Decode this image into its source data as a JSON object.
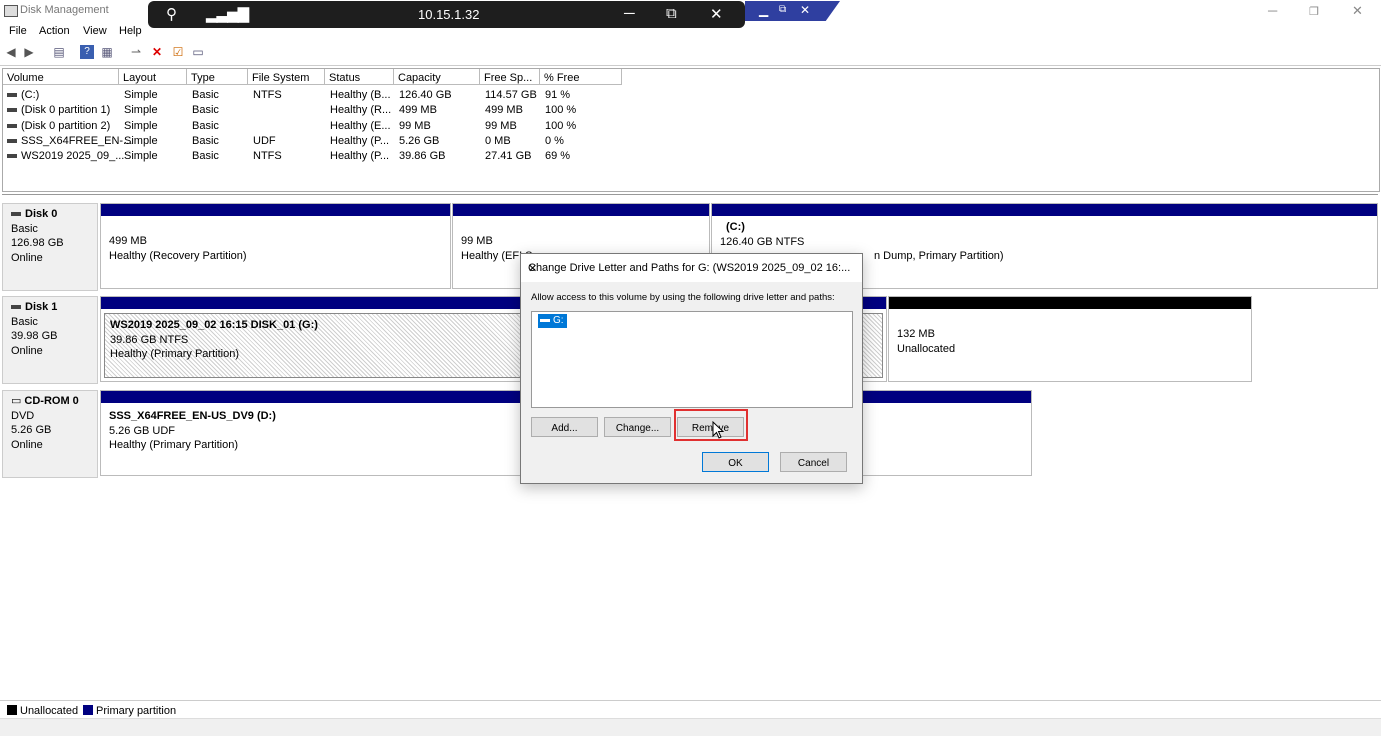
{
  "app": {
    "title": "Disk Management",
    "window_controls": {
      "minimize": "─",
      "restore": "❐",
      "close": "✕"
    }
  },
  "remote_bar": {
    "ip": "10.15.1.32",
    "icons": [
      "pin-off-icon",
      "signal-icon"
    ],
    "controls": {
      "minimize": "─",
      "restore": "⧉",
      "close": "✕"
    },
    "inner_controls": {
      "minimize": "▁",
      "restore": "⧉",
      "close": "✕"
    }
  },
  "menu": [
    "File",
    "Action",
    "View",
    "Help"
  ],
  "toolbar": [
    "back-icon",
    "forward-icon",
    "properties-icon",
    "help-icon",
    "view-icon",
    "rescan-icon",
    "delete-icon",
    "check-icon",
    "settings-icon"
  ],
  "volume_table": {
    "headers": [
      "Volume",
      "Layout",
      "Type",
      "File System",
      "Status",
      "Capacity",
      "Free Sp...",
      "% Free"
    ],
    "rows": [
      {
        "volume": "(C:)",
        "layout": "Simple",
        "type": "Basic",
        "fs": "NTFS",
        "status": "Healthy (B...",
        "capacity": "126.40 GB",
        "free": "114.57 GB",
        "pct": "91 %"
      },
      {
        "volume": "(Disk 0 partition 1)",
        "layout": "Simple",
        "type": "Basic",
        "fs": "",
        "status": "Healthy (R...",
        "capacity": "499 MB",
        "free": "499 MB",
        "pct": "100 %"
      },
      {
        "volume": "(Disk 0 partition 2)",
        "layout": "Simple",
        "type": "Basic",
        "fs": "",
        "status": "Healthy (E...",
        "capacity": "99 MB",
        "free": "99 MB",
        "pct": "100 %"
      },
      {
        "volume": "SSS_X64FREE_EN-...",
        "layout": "Simple",
        "type": "Basic",
        "fs": "UDF",
        "status": "Healthy (P...",
        "capacity": "5.26 GB",
        "free": "0 MB",
        "pct": "0 %"
      },
      {
        "volume": "WS2019 2025_09_...",
        "layout": "Simple",
        "type": "Basic",
        "fs": "NTFS",
        "status": "Healthy (P...",
        "capacity": "39.86 GB",
        "free": "27.41 GB",
        "pct": "69 %"
      }
    ]
  },
  "disks": {
    "disk0": {
      "name": "Disk 0",
      "type": "Basic",
      "size": "126.98 GB",
      "status": "Online",
      "p1": {
        "size": "499 MB",
        "status": "Healthy (Recovery Partition)"
      },
      "p2": {
        "size": "99 MB",
        "status": "Healthy (EFI S"
      },
      "p3": {
        "label": "(C:)",
        "size": "126.40 GB NTFS",
        "status": "n Dump, Primary Partition)"
      }
    },
    "disk1": {
      "name": "Disk 1",
      "type": "Basic",
      "size": "39.98 GB",
      "status": "Online",
      "p1": {
        "label": "WS2019 2025_09_02 16:15 DISK_01  (G:)",
        "size": "39.86 GB NTFS",
        "status": "Healthy (Primary Partition)"
      },
      "p2": {
        "size": "132 MB",
        "status": "Unallocated"
      }
    },
    "cdrom0": {
      "name": "CD-ROM 0",
      "type": "DVD",
      "size": "5.26 GB",
      "status": "Online",
      "p1": {
        "label": "SSS_X64FREE_EN-US_DV9  (D:)",
        "size": "5.26 GB UDF",
        "status": "Healthy (Primary Partition)"
      }
    }
  },
  "legend": {
    "unallocated": "Unallocated",
    "primary": "Primary partition",
    "colors": {
      "unallocated": "#000000",
      "primary": "#000080"
    }
  },
  "dialog": {
    "title": "Change Drive Letter and Paths for G: (WS2019 2025_09_02 16:...",
    "close": "✕",
    "instruction": "Allow access to this volume by using the following drive letter and paths:",
    "items": [
      "G:"
    ],
    "buttons": {
      "add": "Add...",
      "change": "Change...",
      "remove": "Remove",
      "ok": "OK",
      "cancel": "Cancel"
    }
  }
}
